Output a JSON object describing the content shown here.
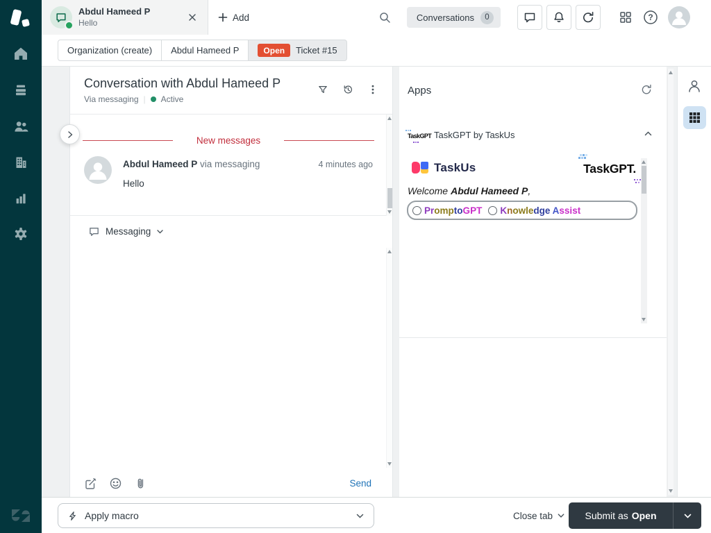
{
  "header": {
    "tab": {
      "title": "Abdul Hameed P",
      "subtitle": "Hello"
    },
    "add_label": "Add",
    "conversations": {
      "label": "Conversations",
      "count": "0"
    },
    "help_glyph": "?"
  },
  "breadcrumb": {
    "organization": "Organization (create)",
    "requester": "Abdul Hameed P",
    "status_badge": "Open",
    "ticket": "Ticket #15"
  },
  "conversation": {
    "title": "Conversation with Abdul Hameed P",
    "via": "Via messaging",
    "status": "Active",
    "new_messages_label": "New messages",
    "message": {
      "author": "Abdul Hameed P",
      "channel": "via messaging",
      "time": "4 minutes ago",
      "text": "Hello"
    },
    "composer": {
      "channel": "Messaging",
      "send_label": "Send"
    }
  },
  "apps": {
    "title": "Apps",
    "section_label": "TaskGPT by TaskUs",
    "section_icon_text": "TaskGPT",
    "taskus_wordmark": "TaskUs",
    "taskgpt_wordmark": "TaskGPT.",
    "welcome_prefix": "Welcome",
    "welcome_name": "Abdul Hameed P",
    "welcome_suffix": ",",
    "options": [
      {
        "text": "PromptoGPT",
        "colors": [
          "#8e3bbd",
          "#8e3bbd",
          "#8c7c1c",
          "#8c7c1c",
          "#8c7c1c",
          "#2f3e9e",
          "#2f3e9e",
          "#c92fc9",
          "#c92fc9",
          "#c92fc9"
        ]
      },
      {
        "text": "Knowledge Assist",
        "colors": [
          "#8e3bbd",
          "#a06a28",
          "#8c7c1c",
          "#8c7c1c",
          "#8c7c1c",
          "#8c7c1c",
          "#2f3e9e",
          "#2f3e9e",
          "#2f3e9e",
          "",
          "#4355c7",
          "#c92fc9",
          "#c92fc9",
          "#c92fc9",
          "#c92fc9",
          "#c92fc9"
        ]
      }
    ]
  },
  "footer": {
    "apply_macro": "Apply macro",
    "close_tab": "Close tab",
    "submit_prefix": "Submit as",
    "submit_status": "Open"
  },
  "colors": {
    "sidebar_bg": "#03363d",
    "open_status": "#e34f32",
    "active_green": "#228f67",
    "new_messages_red": "#c22f3d",
    "send_blue": "#1f73b7",
    "submit_bg": "#2f3941",
    "apps_toggle_selected_bg": "#cfe2f3"
  }
}
